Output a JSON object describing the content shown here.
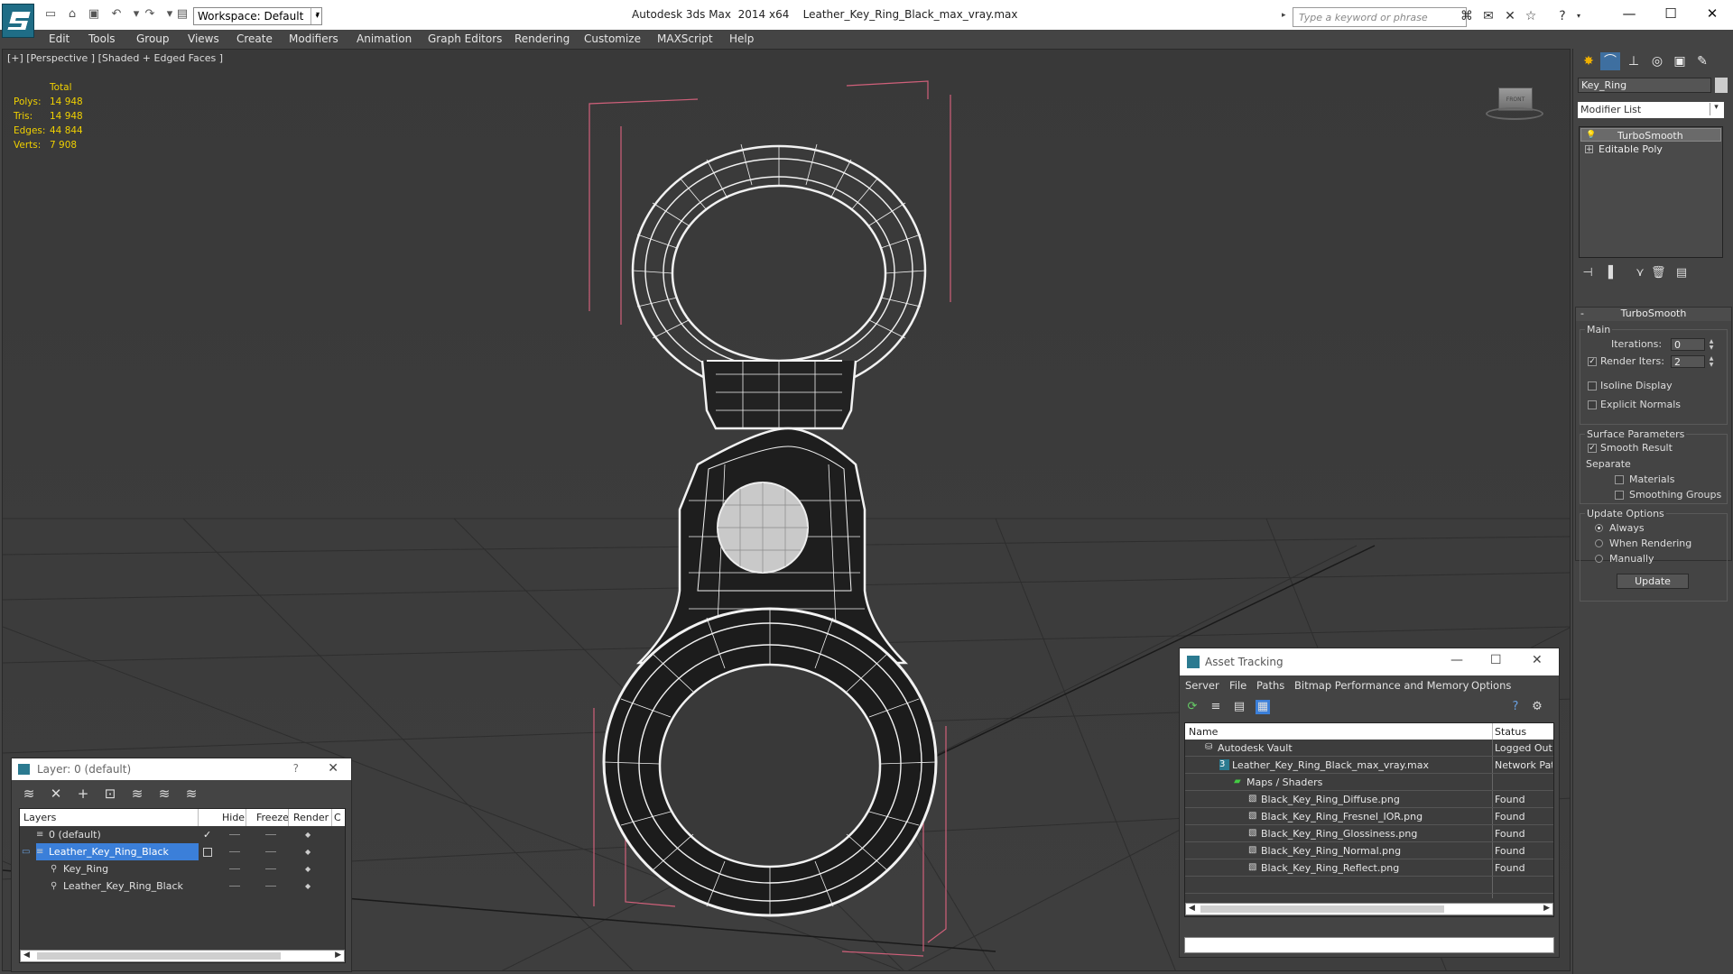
{
  "window": {
    "title_app": "Autodesk 3ds Max  2014 x64",
    "title_file": "Leather_Key_Ring_Black_max_vray.max",
    "workspace": "Workspace: Default",
    "search_placeholder": "Type a keyword or phrase",
    "accent": "#1f6d86"
  },
  "menu": [
    "Edit",
    "Tools",
    "Group",
    "Views",
    "Create",
    "Modifiers",
    "Animation",
    "Graph Editors",
    "Rendering",
    "Customize",
    "MAXScript",
    "Help"
  ],
  "viewport": {
    "label": "[+] [Perspective ] [Shaded + Edged Faces ]",
    "stats": {
      "header": "Total",
      "rows": [
        {
          "k": "Polys:",
          "v": "14 948"
        },
        {
          "k": "Tris:",
          "v": "14 948"
        },
        {
          "k": "Edges:",
          "v": "44 844"
        },
        {
          "k": "Verts:",
          "v": "7 908"
        }
      ],
      "color": "#f0d000"
    },
    "viewcube_label": "FRONT"
  },
  "layer_panel": {
    "title": "Layer: 0 (default)",
    "help": "?",
    "columns": [
      "Layers",
      "Hide",
      "Freeze",
      "Render",
      "C"
    ],
    "rows": [
      {
        "name": "0 (default)",
        "check": "✓"
      },
      {
        "name": "Leather_Key_Ring_Black",
        "selected": true
      },
      {
        "name": "Key_Ring"
      },
      {
        "name": "Leather_Key_Ring_Black"
      }
    ]
  },
  "command_panel": {
    "object_name": "Key_Ring",
    "modifier_list": "Modifier List",
    "stack": [
      "TurboSmooth",
      "Editable Poly"
    ],
    "rollout_title": "TurboSmooth",
    "main_label": "Main",
    "iterations_label": "Iterations:",
    "iterations_value": "0",
    "render_iters_label": "Render Iters:",
    "render_iters_value": "2",
    "isoline_label": "Isoline Display",
    "explicit_label": "Explicit Normals",
    "surface_label": "Surface Parameters",
    "smooth_label": "Smooth Result",
    "separate_label": "Separate",
    "materials_label": "Materials",
    "smoothing_groups_label": "Smoothing Groups",
    "update_options_label": "Update Options",
    "always_label": "Always",
    "when_rendering_label": "When Rendering",
    "manually_label": "Manually",
    "update_button": "Update",
    "render_iters_checked": true,
    "smooth_result_checked": true,
    "update_mode": "Always"
  },
  "asset_tracking": {
    "title": "Asset Tracking",
    "menu": [
      "Server",
      "File",
      "Paths",
      "Bitmap Performance and Memory",
      "Options"
    ],
    "columns": {
      "name": "Name",
      "status": "Status"
    },
    "rows": [
      {
        "name": "Autodesk Vault",
        "status": "Logged Out"
      },
      {
        "name": "Leather_Key_Ring_Black_max_vray.max",
        "status": "Network Pat"
      },
      {
        "name": "Maps / Shaders",
        "status": ""
      },
      {
        "name": "Black_Key_Ring_Diffuse.png",
        "status": "Found"
      },
      {
        "name": "Black_Key_Ring_Fresnel_IOR.png",
        "status": "Found"
      },
      {
        "name": "Black_Key_Ring_Glossiness.png",
        "status": "Found"
      },
      {
        "name": "Black_Key_Ring_Normal.png",
        "status": "Found"
      },
      {
        "name": "Black_Key_Ring_Reflect.png",
        "status": "Found"
      }
    ]
  }
}
